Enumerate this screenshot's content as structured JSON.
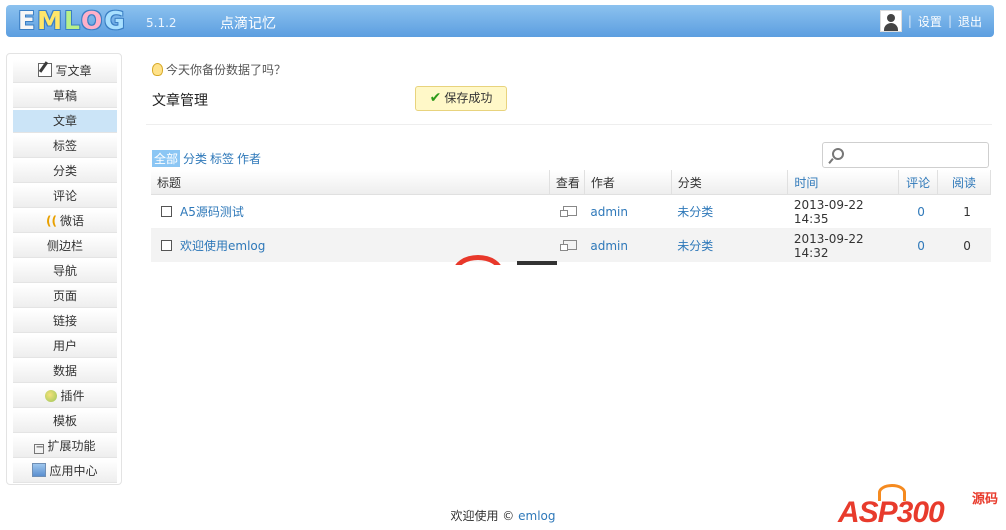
{
  "header": {
    "logo_letters": [
      "E",
      "M",
      "L",
      "O",
      "G"
    ],
    "version": "5.1.2",
    "blog_name": "点滴记忆",
    "settings": "设置",
    "logout": "退出",
    "separator": "|"
  },
  "sidebar": {
    "items": [
      {
        "label": "写文章",
        "icon": "write-icon"
      },
      {
        "label": "草稿"
      },
      {
        "label": "文章",
        "active": true
      },
      {
        "label": "标签"
      },
      {
        "label": "分类"
      },
      {
        "label": "评论"
      },
      {
        "label": "微语",
        "icon": "weibo-icon"
      },
      {
        "label": "侧边栏"
      },
      {
        "label": "导航"
      },
      {
        "label": "页面"
      },
      {
        "label": "链接"
      },
      {
        "label": "用户"
      },
      {
        "label": "数据"
      },
      {
        "label": "插件",
        "icon": "plugin-icon"
      },
      {
        "label": "模板"
      },
      {
        "label": "扩展功能",
        "icon": "expand-icon"
      },
      {
        "label": "应用中心",
        "icon": "app-center-icon"
      }
    ]
  },
  "main": {
    "tip": "今天你备份数据了吗？",
    "title": "文章管理",
    "save_message": "保存成功",
    "filters": [
      "全部",
      "分类",
      "标签",
      "作者"
    ],
    "search_placeholder": ""
  },
  "table": {
    "columns": [
      "标题",
      "查看",
      "作者",
      "分类",
      "时间",
      "评论",
      "阅读"
    ],
    "rows": [
      {
        "title": "A5源码测试",
        "author": "admin",
        "category": "未分类",
        "time": "2013-09-22 14:35",
        "comments": "0",
        "reads": "1"
      },
      {
        "title": "欢迎使用emlog",
        "author": "admin",
        "category": "未分类",
        "time": "2013-09-22 14:32",
        "comments": "0",
        "reads": "0"
      }
    ]
  },
  "footer": {
    "text": "欢迎使用 ©",
    "link": "emlog"
  },
  "watermark": {
    "text": "ASP300",
    "text2": "源码",
    "color": "#e83b2c"
  },
  "colors": {
    "header": "#5c9ee0",
    "link": "#2e78b9",
    "active_sidebar": "#cbe4f7"
  }
}
